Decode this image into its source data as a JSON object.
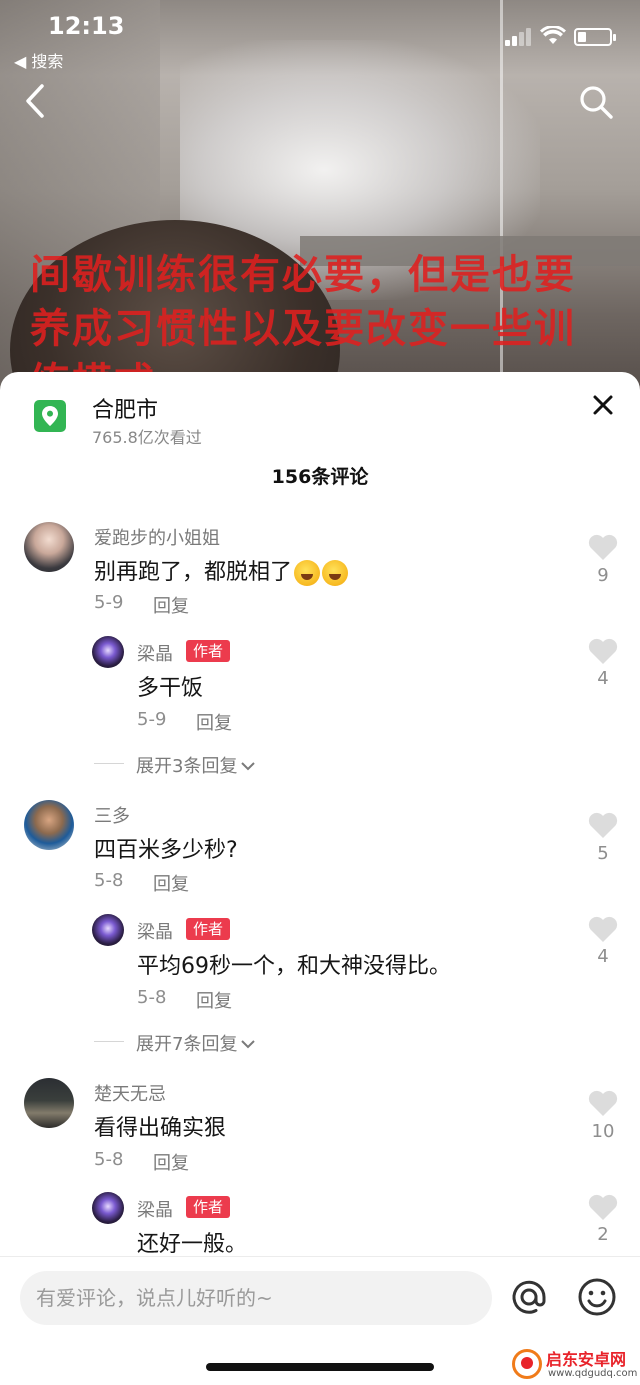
{
  "status_bar": {
    "time": "12:13",
    "back_app": "◀ 搜索"
  },
  "video": {
    "overlay_text": "间歇训练很有必要，但是也要养成习惯性以及要改变一些训练模式"
  },
  "location": {
    "name": "合肥市",
    "views": "765.8亿次看过"
  },
  "comments_title": "156条评论",
  "comments": [
    {
      "user": "爱跑步的小姐姐",
      "text": "别再跑了，都脱相了",
      "date": "5-9",
      "reply_label": "回复",
      "likes": "9",
      "author_reply": {
        "user": "梁晶",
        "badge": "作者",
        "text": "多干饭",
        "date": "5-9",
        "reply_label": "回复",
        "likes": "4"
      },
      "expand": "展开3条回复"
    },
    {
      "user": "三多",
      "text": "四百米多少秒?",
      "date": "5-8",
      "reply_label": "回复",
      "likes": "5",
      "author_reply": {
        "user": "梁晶",
        "badge": "作者",
        "text": "平均69秒一个，和大神没得比。",
        "date": "5-8",
        "reply_label": "回复",
        "likes": "4"
      },
      "expand": "展开7条回复"
    },
    {
      "user": "楚天无忌",
      "text": "看得出确实狠",
      "date": "5-8",
      "reply_label": "回复",
      "likes": "10",
      "author_reply": {
        "user": "梁晶",
        "badge": "作者",
        "text": "还好一般。",
        "likes": "2"
      }
    }
  ],
  "input": {
    "placeholder": "有爱评论，说点儿好听的~"
  },
  "watermark": {
    "title": "启东安卓网",
    "sub": "www.qdgudq.com"
  },
  "colors": {
    "author_badge": "#ec3b4d",
    "location_icon": "#32b553",
    "overlay_text": "#e0201f"
  }
}
